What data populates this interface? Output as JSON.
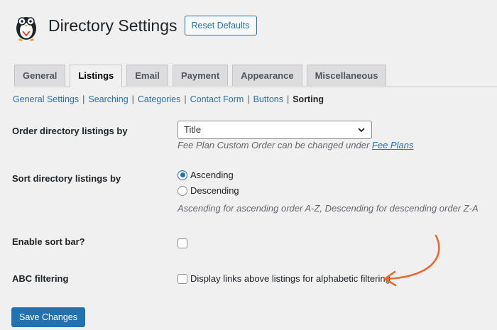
{
  "header": {
    "title": "Directory Settings",
    "reset_label": "Reset Defaults"
  },
  "tabs": [
    {
      "label": "General",
      "active": false
    },
    {
      "label": "Listings",
      "active": true
    },
    {
      "label": "Email",
      "active": false
    },
    {
      "label": "Payment",
      "active": false
    },
    {
      "label": "Appearance",
      "active": false
    },
    {
      "label": "Miscellaneous",
      "active": false
    }
  ],
  "subnav": {
    "items": [
      "General Settings",
      "Searching",
      "Categories",
      "Contact Form",
      "Buttons"
    ],
    "current": "Sorting",
    "separator": "|"
  },
  "order": {
    "label": "Order directory listings by",
    "selected": "Title",
    "desc_prefix": "Fee Plan Custom Order can be changed under",
    "desc_link": "Fee Plans"
  },
  "sort": {
    "label": "Sort directory listings by",
    "options": [
      {
        "label": "Ascending",
        "checked": true
      },
      {
        "label": "Descending",
        "checked": false
      }
    ],
    "desc": "Ascending for ascending order A-Z, Descending for descending order Z-A"
  },
  "sortbar": {
    "label": "Enable sort bar?",
    "checked": false
  },
  "abc": {
    "label": "ABC filtering",
    "checkbox_label": "Display links above listings for alphabetic filtering",
    "checked": false
  },
  "save_label": "Save Changes",
  "colors": {
    "accent": "#2271b1",
    "arrow": "#e8662a"
  }
}
